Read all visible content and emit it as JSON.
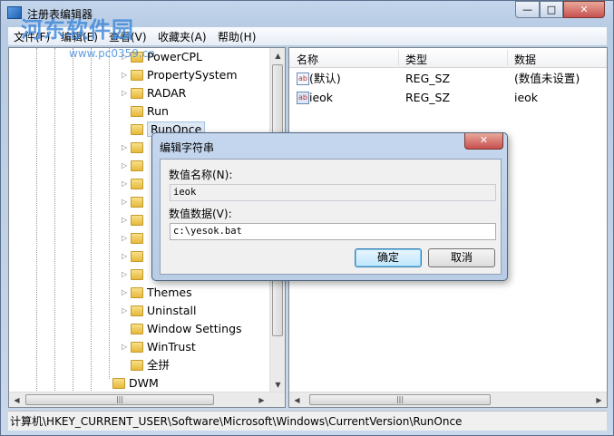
{
  "window": {
    "title": "注册表编辑器",
    "controls": {
      "minimize": "—",
      "maximize": "□",
      "close": "✕"
    }
  },
  "watermark": {
    "brand": "河东软件园",
    "url": "www.pc0359.cn"
  },
  "menu": [
    {
      "label": "文件(F)"
    },
    {
      "label": "编辑(E)"
    },
    {
      "label": "查看(V)"
    },
    {
      "label": "收藏夹(A)"
    },
    {
      "label": "帮助(H)"
    }
  ],
  "tree": {
    "items": [
      {
        "label": "PowerCPL",
        "expandable": true,
        "selected": false
      },
      {
        "label": "PropertySystem",
        "expandable": true,
        "selected": false
      },
      {
        "label": "RADAR",
        "expandable": true,
        "selected": false
      },
      {
        "label": "Run",
        "expandable": false,
        "selected": false
      },
      {
        "label": "RunOnce",
        "expandable": false,
        "selected": true
      },
      {
        "label": "",
        "expandable": true
      },
      {
        "label": "",
        "expandable": true
      },
      {
        "label": "",
        "expandable": true
      },
      {
        "label": "",
        "expandable": true
      },
      {
        "label": "",
        "expandable": true
      },
      {
        "label": "",
        "expandable": true
      },
      {
        "label": "",
        "expandable": true
      },
      {
        "label": "",
        "expandable": true
      },
      {
        "label": "Themes",
        "expandable": true,
        "selected": false
      },
      {
        "label": "Uninstall",
        "expandable": true,
        "selected": false
      },
      {
        "label": "Window Settings",
        "expandable": false,
        "selected": false
      },
      {
        "label": "WinTrust",
        "expandable": true,
        "selected": false
      },
      {
        "label": "全拼",
        "expandable": false,
        "selected": false
      }
    ],
    "parent_item": {
      "label": "DWM"
    }
  },
  "list": {
    "columns": [
      "名称",
      "类型",
      "数据"
    ],
    "rows": [
      {
        "name": "(默认)",
        "type": "REG_SZ",
        "data": "(数值未设置)",
        "icon": "ab"
      },
      {
        "name": "ieok",
        "type": "REG_SZ",
        "data": "ieok",
        "icon": "ab"
      }
    ]
  },
  "dialog": {
    "title": "编辑字符串",
    "close": "✕",
    "name_label": "数值名称(N):",
    "name_value": "ieok",
    "data_label": "数值数据(V):",
    "data_value": "c:\\yesok.bat",
    "ok_label": "确定",
    "cancel_label": "取消"
  },
  "statusbar": {
    "path": "计算机\\HKEY_CURRENT_USER\\Software\\Microsoft\\Windows\\CurrentVersion\\RunOnce"
  },
  "colors": {
    "accent": "#3c7fb1",
    "close": "#c75050",
    "selection": "#dde8f5"
  }
}
